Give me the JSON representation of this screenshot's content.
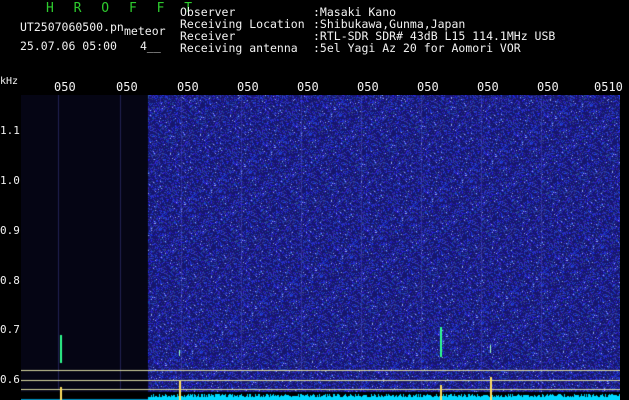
{
  "header": {
    "title": "H R O F F T",
    "filename": "UT2507060500.pn",
    "meteor_label": "meteor",
    "datetime": "25.07.06 05:00",
    "number": "4__",
    "info": [
      {
        "label": "Observer",
        "value": ":Masaki Kano"
      },
      {
        "label": "Receiving Location",
        "value": ":Shibukawa,Gunma,Japan"
      },
      {
        "label": "Receiver",
        "value": ":RTL-SDR SDR# 43dB L15 114.1MHz USB"
      },
      {
        "label": "Receiving antenna",
        "value": ":5el Yagi Az 20 for Aomori VOR"
      }
    ]
  },
  "y_axis": {
    "unit": "kHz",
    "labels": [
      "1.1",
      "1.0",
      "0.9",
      "0.8",
      "0.7",
      "0.6"
    ]
  },
  "time_axis": {
    "labels": [
      "050",
      "050",
      "050",
      "050",
      "050",
      "050",
      "050",
      "050",
      "050",
      "0510"
    ]
  },
  "colors": {
    "background": "#000000",
    "waterfall": "#1a1a7a",
    "noise_floor": "#00e0ff",
    "guide_lines": "#d8d8a0",
    "text": "#f2f2f2",
    "title": "#2ecc2e"
  }
}
